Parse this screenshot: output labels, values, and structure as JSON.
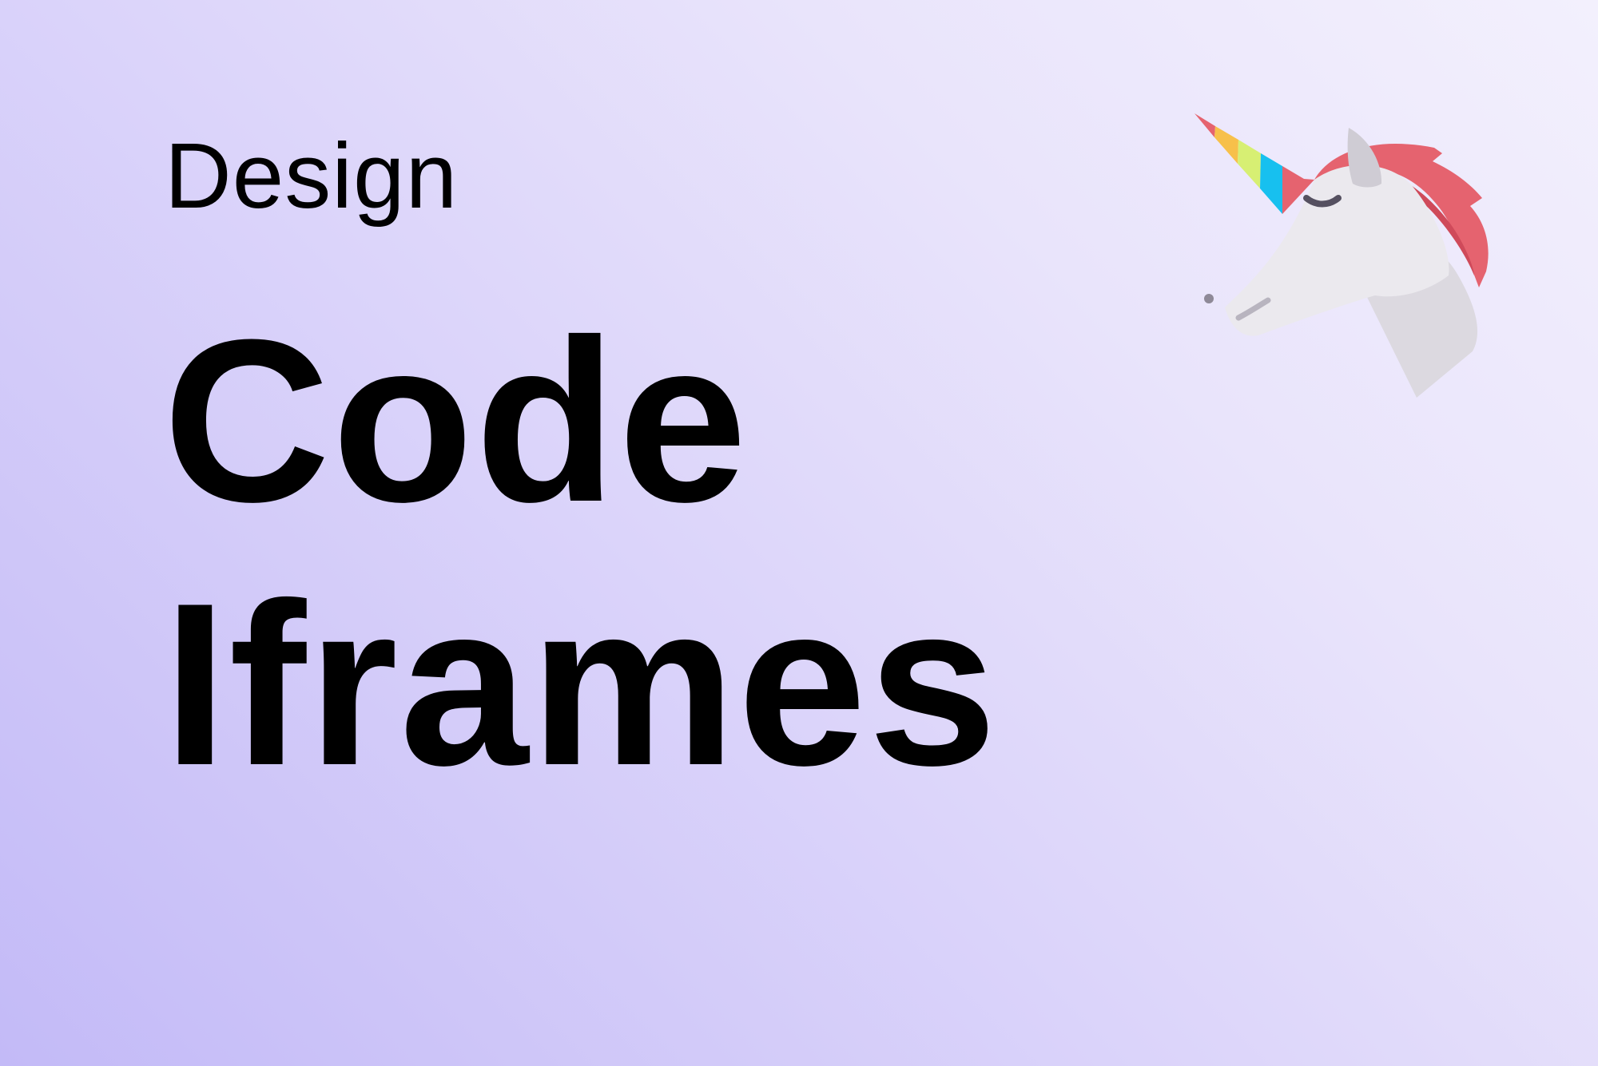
{
  "card": {
    "category": "Design",
    "title_lines": [
      "Code",
      "Iframes"
    ],
    "mascot_icon": "unicorn-icon"
  },
  "colors": {
    "background_start": "#c3baf7",
    "background_end": "#f3f0fd",
    "text": "#000000",
    "mane": "#e5636f",
    "horn_stripes": [
      "#e5636f",
      "#f7c04a",
      "#d7ef73",
      "#17c0ef"
    ],
    "head": "#ebe9ee"
  }
}
